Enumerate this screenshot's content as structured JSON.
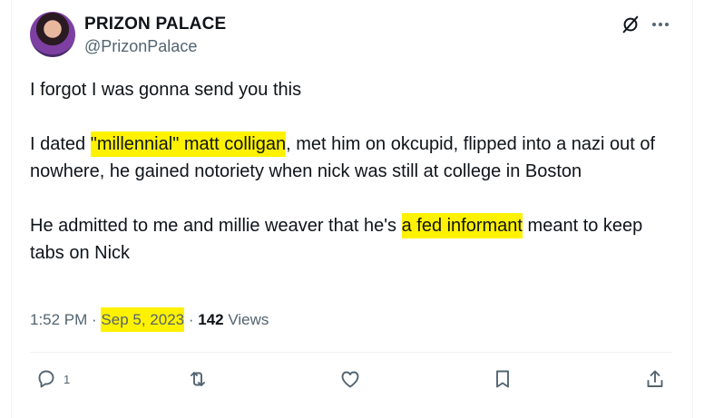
{
  "author": {
    "display_name": "PRIZON PALACE",
    "handle": "@PrizonPalace"
  },
  "tweet": {
    "p1": "I forgot I was gonna send you this",
    "p2_a": "I dated ",
    "p2_hl": "\"millennial\" matt colligan",
    "p2_b": ", met him on okcupid, flipped into a nazi out of nowhere, he gained notoriety when nick was still at college in Boston",
    "p3_a": "He admitted to me and millie weaver that he's ",
    "p3_hl": "a fed informant",
    "p3_b": " meant to keep tabs on Nick"
  },
  "meta": {
    "time": "1:52 PM",
    "sep1": " · ",
    "date": "Sep 5, 2023",
    "sep2": " · ",
    "views": "142",
    "views_label": " Views"
  },
  "actions": {
    "reply_count": "1"
  },
  "icons": {
    "top_right": [
      "grok-icon",
      "more-icon"
    ],
    "action_bar": [
      "reply-icon",
      "retweet-icon",
      "like-icon",
      "bookmark-icon",
      "share-icon"
    ]
  },
  "colors": {
    "highlight": "#fff200",
    "secondary_text": "#536471",
    "primary_text": "#0f1419"
  }
}
